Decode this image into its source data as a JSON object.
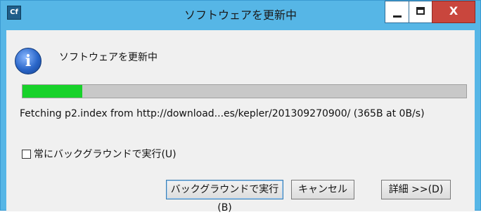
{
  "window": {
    "title": "ソフトウェアを更新中",
    "app_icon_text": "Cf",
    "controls": {
      "minimize": "_",
      "maximize": "□",
      "close": "X"
    }
  },
  "dialog": {
    "message": "ソフトウェアを更新中",
    "progress_fraction": 0.135,
    "status_text": "Fetching p2.index from http://download...es/kepler/201309270900/ (365B at 0B/s)",
    "checkbox": {
      "label": "常にバックグラウンドで実行(U)",
      "checked": false
    }
  },
  "buttons": {
    "run_in_background": "バックグラウンドで実行(B)",
    "cancel": "キャンセル",
    "details": "詳細 >>(D)"
  },
  "colors": {
    "titlebar": "#56b6e6",
    "progress_fill": "#18d22a",
    "close_button": "#c9463d"
  }
}
